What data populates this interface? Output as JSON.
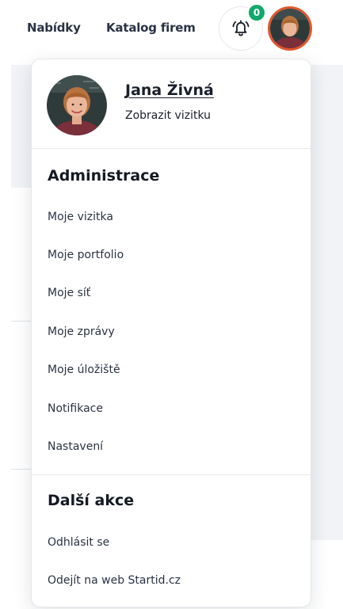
{
  "nav": {
    "links": [
      "Nabídky",
      "Katalog firem"
    ],
    "notifications": {
      "count": "0",
      "icon": "bell-icon"
    },
    "avatar_border_color": "#e4562b"
  },
  "dropdown": {
    "profile": {
      "name": "Jana Živná",
      "link": "Zobrazit vizitku"
    },
    "sections": [
      {
        "title": "Administrace",
        "items": [
          "Moje vizitka",
          "Moje portfolio",
          "Moje síť",
          "Moje zprávy",
          "Moje úložiště",
          "Notifikace",
          "Nastavení"
        ]
      },
      {
        "title": "Další akce",
        "items": [
          "Odhlásit se",
          "Odejít na web Startid.cz"
        ]
      }
    ]
  },
  "colors": {
    "badge": "#12a86b",
    "text": "#1a1f2b"
  }
}
